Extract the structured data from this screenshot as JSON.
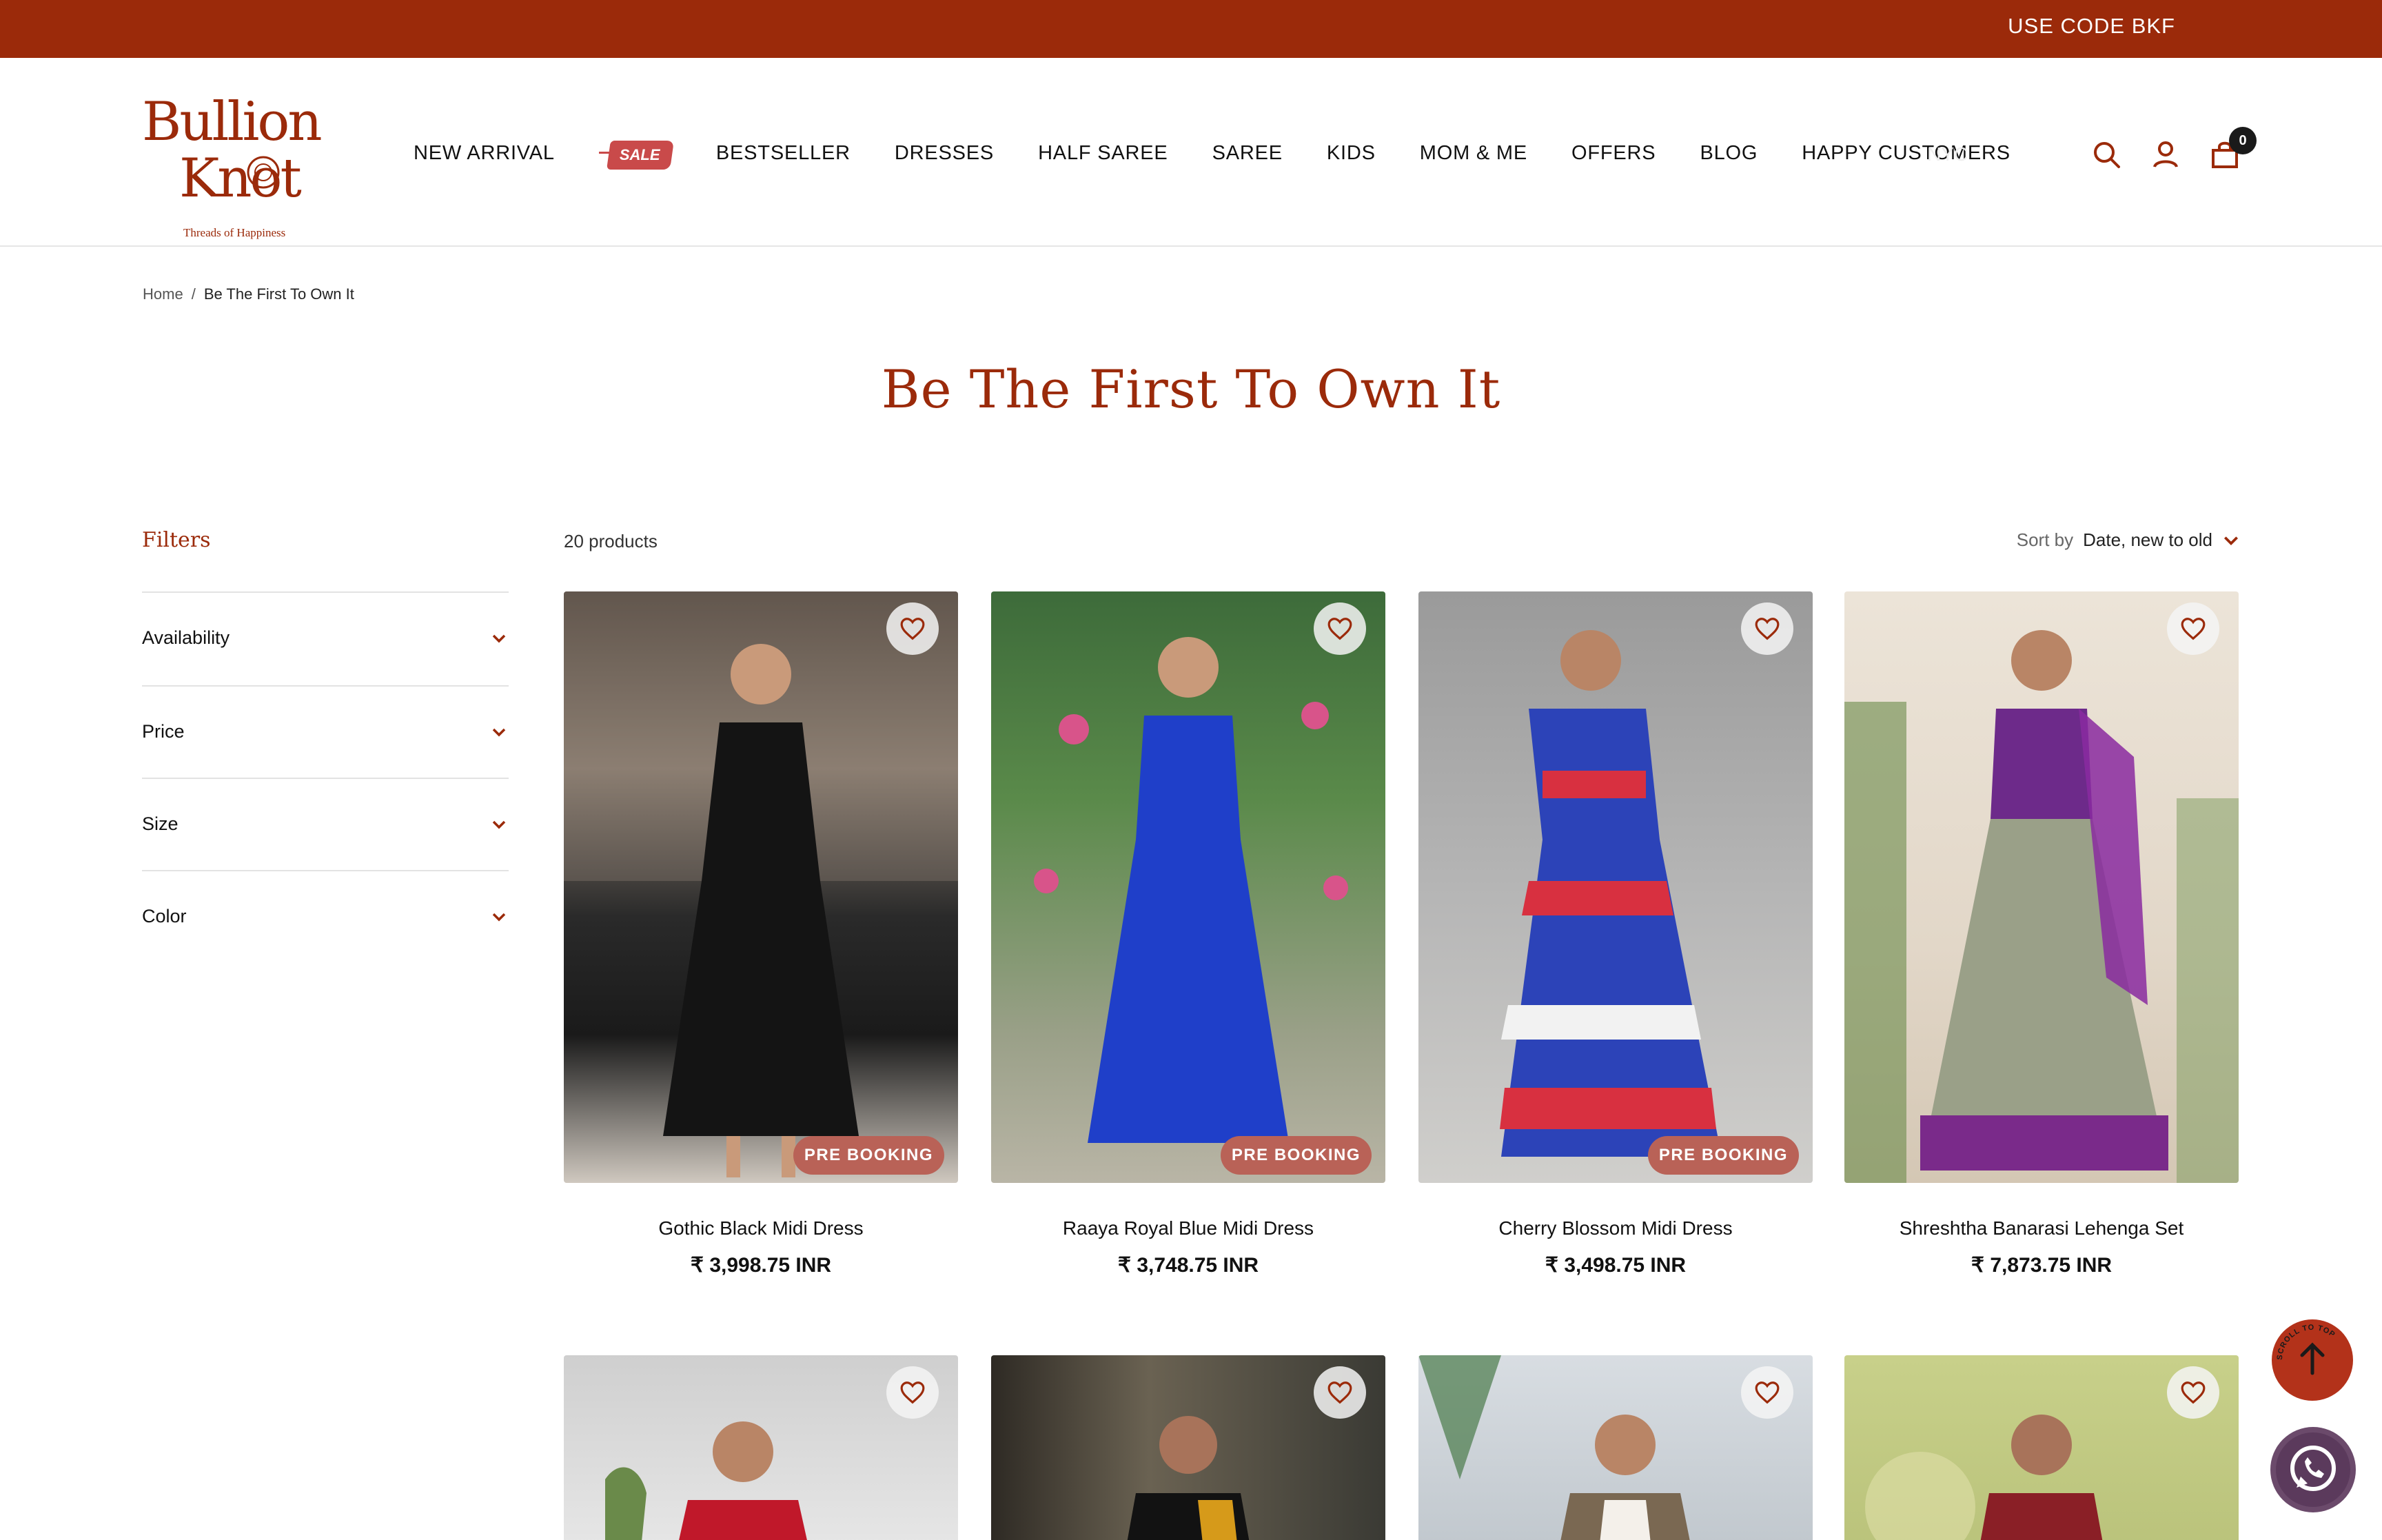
{
  "announcement": {
    "text": "USE CODE BKF"
  },
  "brand": {
    "word1": "Bullion",
    "word2": "Knot",
    "tagline": "Threads of Happiness",
    "color": "#9b2a0a"
  },
  "nav": {
    "items": [
      "NEW ARRIVAL",
      "BESTSELLER",
      "DRESSES",
      "HALF SAREE",
      "SAREE",
      "KIDS",
      "MOM & ME",
      "OFFERS",
      "BLOG",
      "HAPPY CUSTOMERS"
    ],
    "sale_label": "SALE",
    "faded_item": "NYC"
  },
  "header_icons": {
    "search": "search-icon",
    "account": "user-icon",
    "cart": "cart-icon",
    "cart_count": "0"
  },
  "breadcrumb": {
    "home": "Home",
    "separator": "/",
    "current": "Be The First To Own It"
  },
  "page": {
    "title": "Be The First To Own It"
  },
  "filters": {
    "title": "Filters",
    "groups": [
      "Availability",
      "Price",
      "Size",
      "Color"
    ]
  },
  "toolbar": {
    "count": "20 products",
    "sort_label": "Sort by",
    "sort_value": "Date, new to old"
  },
  "products": [
    {
      "name": "Gothic Black Midi Dress",
      "price": "₹ 3,998.75 INR",
      "badge": "PRE BOOKING"
    },
    {
      "name": "Raaya Royal Blue Midi Dress",
      "price": "₹ 3,748.75 INR",
      "badge": "PRE BOOKING"
    },
    {
      "name": "Cherry Blossom Midi Dress",
      "price": "₹ 3,498.75 INR",
      "badge": "PRE BOOKING"
    },
    {
      "name": "Shreshtha Banarasi Lehenga Set",
      "price": "₹ 7,873.75 INR",
      "badge": ""
    }
  ],
  "floating": {
    "scroll_top": "SCROLL TO TOP",
    "whatsapp": "whatsapp-icon"
  },
  "colors": {
    "accent": "#9b2a0a",
    "badge": "#b96257"
  }
}
